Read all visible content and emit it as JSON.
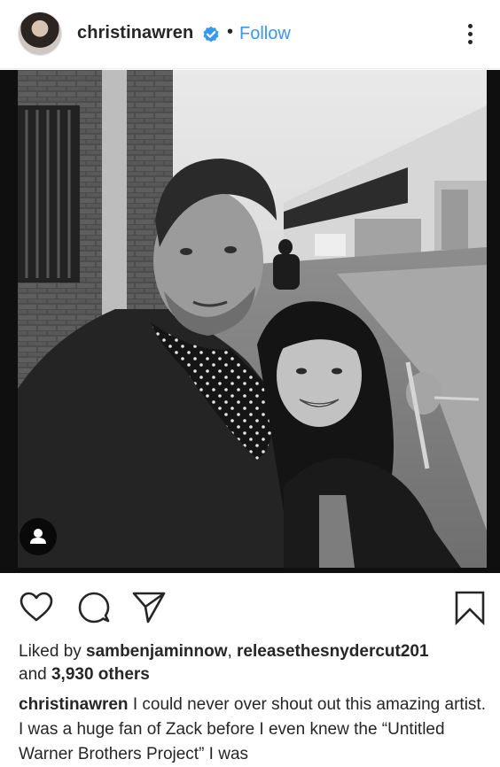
{
  "header": {
    "username": "christinawren",
    "verified_icon": "verified-badge-icon",
    "separator": "•",
    "follow_label": "Follow",
    "more_icon": "more-options-icon",
    "accent_color": "#3897f0"
  },
  "post": {
    "image_style": "black-and-white selfie photo",
    "user_tag_icon": "user-tag-icon"
  },
  "actions": {
    "like_icon": "heart-icon",
    "comment_icon": "comment-icon",
    "share_icon": "share-icon",
    "save_icon": "bookmark-icon"
  },
  "likes": {
    "prefix": "Liked by ",
    "user1": "sambenjaminnow",
    "sep": ", ",
    "user2": "releasethesnydercut201",
    "and": "and ",
    "others": "3,930 others"
  },
  "caption": {
    "username": "christinawren",
    "text": " I could never over shout out this amazing artist. I was a huge fan of Zack before I even knew the “Untitled Warner Brothers Project” I was"
  }
}
